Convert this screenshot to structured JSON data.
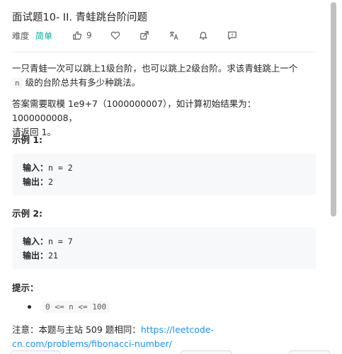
{
  "problem": {
    "title": "面试题10- II. 青蛙跳台阶问题",
    "difficulty_label": "难度",
    "difficulty_value": "简单",
    "like_count": "9"
  },
  "description": {
    "p1_text": "一只青蛙一次可以跳上1级台阶，也可以跳上2级台阶。求该青蛙跳上一个",
    "p1_code": "n",
    "p1_tail": "级的台阶总共有多少种跳法。",
    "p2_line1": "答案需要取模 1e9+7（1000000007），如计算初始结果为：1000000008，",
    "p2_line2": "请返回 1。"
  },
  "examples": [
    {
      "heading": "示例 1:",
      "input_label": "输入：",
      "input_value": "n = 2",
      "output_label": "输出：",
      "output_value": "2"
    },
    {
      "heading": "示例 2:",
      "input_label": "输入：",
      "input_value": "n = 7",
      "output_label": "输出：",
      "output_value": "21"
    }
  ],
  "hints": {
    "heading": "提示：",
    "items": [
      "0 <= n <= 100"
    ]
  },
  "note": {
    "prefix": "注意：本题与主站 509 题相同：",
    "link_text": "https://leetcode-cn.com/problems/fibonacci-number/"
  },
  "icons": {
    "like": "thumbs-up-icon",
    "favorite": "heart-icon",
    "share": "share-icon",
    "translate": "translate-icon",
    "notify": "bell-icon",
    "feedback": "feedback-icon"
  },
  "colors": {
    "easy": "#00af9b",
    "link": "#1a90ff",
    "code_bg": "#f7f8fa"
  }
}
